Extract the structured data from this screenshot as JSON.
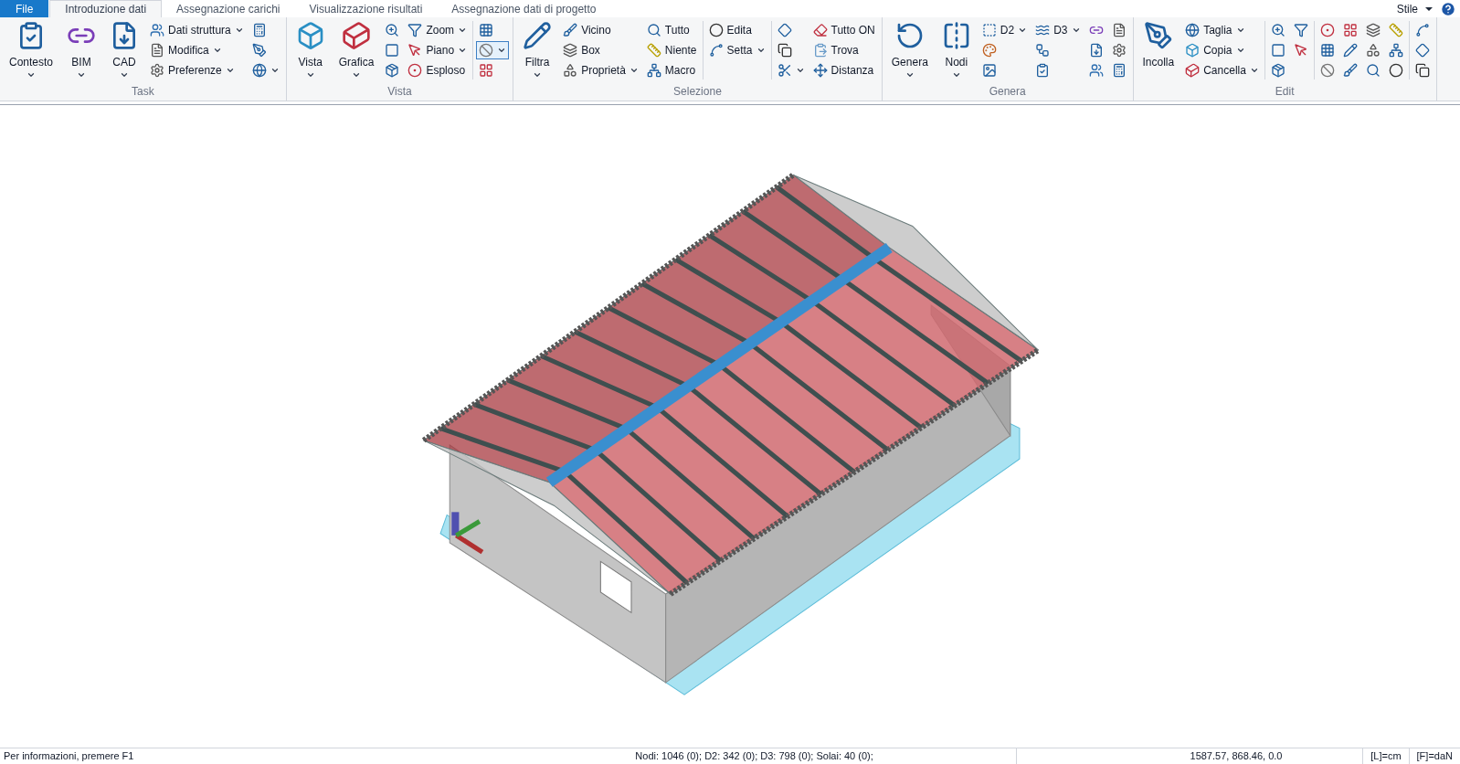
{
  "tabs": [
    {
      "label": "File",
      "kind": "file",
      "selected": false
    },
    {
      "label": "Introduzione dati",
      "kind": "tab",
      "selected": true
    },
    {
      "label": "Assegnazione carichi",
      "kind": "tab",
      "selected": false
    },
    {
      "label": "Visualizzazione risultati",
      "kind": "tab",
      "selected": false
    },
    {
      "label": "Assegnazione dati di progetto",
      "kind": "tab",
      "selected": false
    }
  ],
  "style_menu": "Stile",
  "groups": [
    {
      "title": "Task",
      "columns": [
        {
          "kind": "large",
          "label": "Contesto",
          "dropdown": true
        },
        {
          "kind": "large",
          "label": "BIM",
          "dropdown": true
        },
        {
          "kind": "large",
          "label": "CAD",
          "dropdown": true
        },
        {
          "kind": "stack",
          "items": [
            {
              "label": "Dati struttura",
              "dropdown": true
            },
            {
              "label": "Modifica",
              "dropdown": true
            },
            {
              "label": "Preferenze",
              "dropdown": true
            }
          ]
        },
        {
          "kind": "stack",
          "items": [
            {
              "dropdown": false
            },
            {
              "dropdown": false
            },
            {
              "dropdown": true
            }
          ]
        }
      ]
    },
    {
      "title": "Vista",
      "columns": [
        {
          "kind": "large",
          "label": "Vista",
          "dropdown": true
        },
        {
          "kind": "large",
          "label": "Grafica",
          "dropdown": true
        },
        {
          "kind": "stack",
          "items": [
            {
              "dropdown": false
            },
            {
              "dropdown": false
            },
            {
              "dropdown": false
            }
          ]
        },
        {
          "kind": "stack",
          "items": [
            {
              "label": "Zoom",
              "dropdown": true
            },
            {
              "label": "Piano",
              "dropdown": true
            },
            {
              "label": "Esploso",
              "dropdown": false
            }
          ]
        },
        {
          "kind": "sep"
        },
        {
          "kind": "stack",
          "items": [
            {
              "dropdown": false,
              "pressed": false
            },
            {
              "dropdown": true,
              "pressed": true
            },
            {
              "dropdown": false,
              "pressed": false
            }
          ]
        }
      ]
    },
    {
      "title": "Selezione",
      "columns": [
        {
          "kind": "large",
          "label": "Filtra",
          "dropdown": true
        },
        {
          "kind": "stack",
          "items": [
            {
              "label": "Vicino",
              "dropdown": false
            },
            {
              "label": "Box",
              "dropdown": false
            },
            {
              "label": "Proprietà",
              "dropdown": true
            }
          ]
        },
        {
          "kind": "stack",
          "items": [
            {
              "label": "Tutto",
              "dropdown": false
            },
            {
              "label": "Niente",
              "dropdown": false
            },
            {
              "label": "Macro",
              "dropdown": false
            }
          ]
        },
        {
          "kind": "sep"
        },
        {
          "kind": "stack",
          "items": [
            {
              "label": "Edita",
              "dropdown": false
            },
            {
              "label": "Setta",
              "dropdown": true
            }
          ]
        },
        {
          "kind": "sep"
        },
        {
          "kind": "stack",
          "items": [
            {
              "dropdown": false
            },
            {
              "dropdown": false
            },
            {
              "dropdown": true
            }
          ]
        },
        {
          "kind": "stack",
          "items": [
            {
              "label": "Tutto ON",
              "dropdown": false
            },
            {
              "label": "Trova",
              "dropdown": false
            },
            {
              "label": "Distanza",
              "dropdown": false
            }
          ]
        }
      ]
    },
    {
      "title": "Genera",
      "columns": [
        {
          "kind": "large",
          "label": "Genera",
          "dropdown": true
        },
        {
          "kind": "large",
          "label": "Nodi",
          "dropdown": true
        },
        {
          "kind": "stack",
          "items": [
            {
              "label": "D2",
              "dropdown": true
            },
            {
              "dropdown": false
            },
            {
              "dropdown": false
            }
          ]
        },
        {
          "kind": "stack",
          "items": [
            {
              "label": "D3",
              "dropdown": true
            },
            {
              "dropdown": false
            },
            {
              "dropdown": false
            }
          ]
        },
        {
          "kind": "stack",
          "items": [
            {
              "dropdown": false
            },
            {
              "dropdown": false
            },
            {
              "dropdown": false
            }
          ]
        },
        {
          "kind": "stack",
          "items": [
            {
              "dropdown": false
            },
            {
              "dropdown": false
            },
            {
              "dropdown": false
            }
          ]
        }
      ]
    },
    {
      "title": "Edit",
      "columns": [
        {
          "kind": "large",
          "label": "Incolla",
          "dropdown": false
        },
        {
          "kind": "stack",
          "items": [
            {
              "label": "Taglia",
              "dropdown": true
            },
            {
              "label": "Copia",
              "dropdown": true
            },
            {
              "label": "Cancella",
              "dropdown": true
            }
          ]
        },
        {
          "kind": "sep"
        },
        {
          "kind": "stack",
          "items": [
            {
              "dropdown": false
            },
            {
              "dropdown": false
            },
            {
              "dropdown": false
            }
          ]
        },
        {
          "kind": "stack",
          "items": [
            {
              "dropdown": false
            },
            {
              "dropdown": false
            }
          ]
        },
        {
          "kind": "sep"
        },
        {
          "kind": "stack",
          "items": [
            {
              "dropdown": false
            },
            {
              "dropdown": false
            },
            {
              "dropdown": false
            }
          ]
        },
        {
          "kind": "stack",
          "items": [
            {
              "dropdown": false
            },
            {
              "dropdown": false
            },
            {
              "dropdown": false
            }
          ]
        },
        {
          "kind": "stack",
          "items": [
            {
              "dropdown": false
            },
            {
              "dropdown": false
            },
            {
              "dropdown": false
            }
          ]
        },
        {
          "kind": "stack",
          "items": [
            {
              "dropdown": false
            },
            {
              "dropdown": false
            },
            {
              "dropdown": false
            }
          ]
        },
        {
          "kind": "sep"
        },
        {
          "kind": "stack",
          "items": [
            {
              "dropdown": false
            },
            {
              "dropdown": false
            },
            {
              "dropdown": false
            }
          ]
        }
      ]
    }
  ],
  "status_bar": {
    "hint": "Per informazioni, premere F1",
    "counts": "Nodi: 1046 (0); D2: 342 (0); D3: 798 (0); Solai: 40 (0);",
    "coordinates": "1587.57, 868.46, 0.0",
    "length_unit": "[L]=cm",
    "force_unit": "[F]=daN"
  }
}
